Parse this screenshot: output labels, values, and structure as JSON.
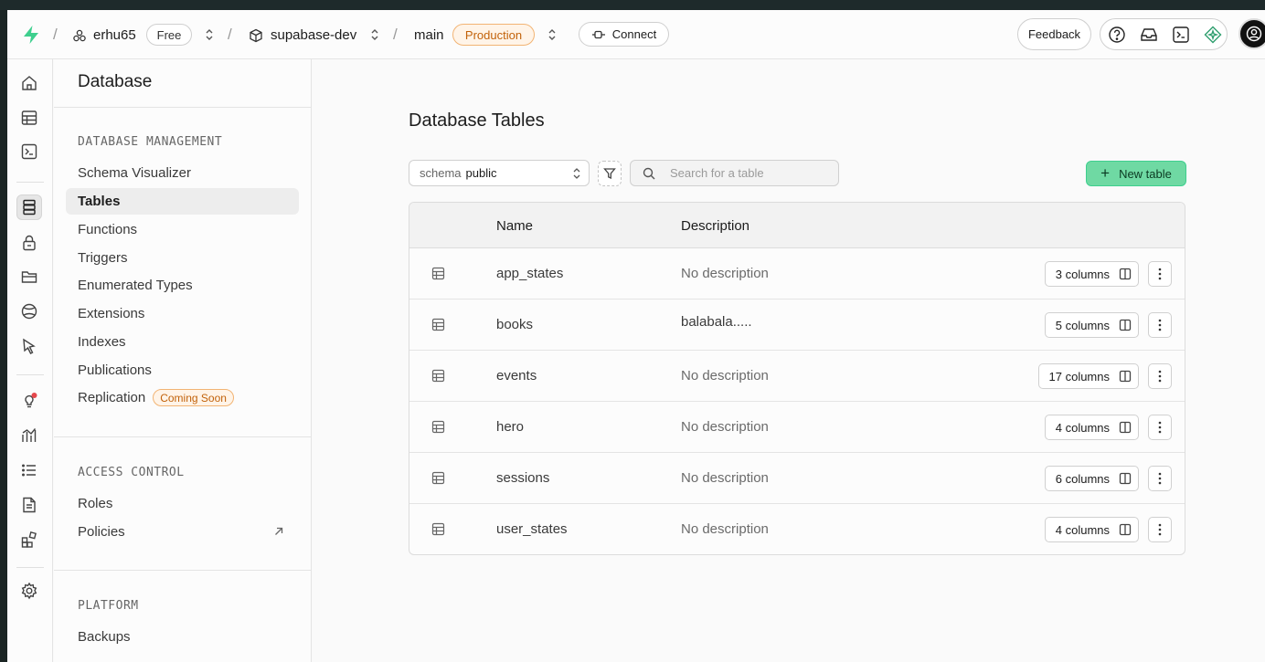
{
  "header": {
    "org_name": "erhu65",
    "plan_badge": "Free",
    "project_name": "supabase-dev",
    "branch_name": "main",
    "env_badge": "Production",
    "connect_label": "Connect",
    "feedback_label": "Feedback"
  },
  "sidebar": {
    "title": "Database",
    "sections": [
      {
        "title": "DATABASE MANAGEMENT",
        "items": [
          {
            "label": "Schema Visualizer"
          },
          {
            "label": "Tables"
          },
          {
            "label": "Functions"
          },
          {
            "label": "Triggers"
          },
          {
            "label": "Enumerated Types"
          },
          {
            "label": "Extensions"
          },
          {
            "label": "Indexes"
          },
          {
            "label": "Publications"
          },
          {
            "label": "Replication",
            "badge": "Coming Soon"
          }
        ]
      },
      {
        "title": "ACCESS CONTROL",
        "items": [
          {
            "label": "Roles"
          },
          {
            "label": "Policies"
          }
        ]
      },
      {
        "title": "PLATFORM",
        "items": [
          {
            "label": "Backups"
          }
        ]
      }
    ]
  },
  "main": {
    "title": "Database Tables",
    "schema_label": "schema",
    "schema_value": "public",
    "search_placeholder": "Search for a table",
    "new_table_label": "New table",
    "columns": {
      "name": "Name",
      "description": "Description"
    },
    "rows": [
      {
        "name": "app_states",
        "description": "No description",
        "columns": "3 columns"
      },
      {
        "name": "books",
        "description": "balabala.....",
        "columns": "5 columns"
      },
      {
        "name": "events",
        "description": "No description",
        "columns": "17 columns"
      },
      {
        "name": "hero",
        "description": "No description",
        "columns": "4 columns"
      },
      {
        "name": "sessions",
        "description": "No description",
        "columns": "6 columns"
      },
      {
        "name": "user_states",
        "description": "No description",
        "columns": "4 columns"
      }
    ]
  },
  "colors": {
    "brand": "#3ecf8e",
    "warning": "#c2620a"
  }
}
